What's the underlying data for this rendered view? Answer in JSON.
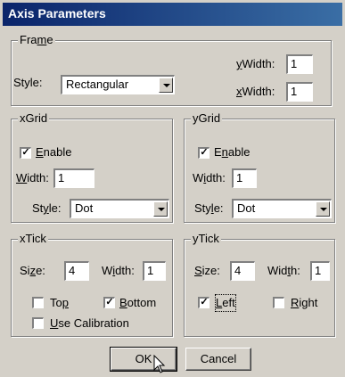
{
  "window": {
    "title": "Axis Parameters"
  },
  "frame": {
    "label_pre": "Fra",
    "label_u": "m",
    "label_post": "e",
    "style_label": "Style:",
    "style_value": "Rectangular",
    "ywidth_u": "y",
    "ywidth_post": "Width:",
    "ywidth_value": "1",
    "xwidth_u": "x",
    "xwidth_post": "Width:",
    "xwidth_value": "1"
  },
  "xgrid": {
    "label": "xGrid",
    "enable_u": "E",
    "enable_post": "nable",
    "enable_checked": true,
    "width_u": "W",
    "width_post": "idth:",
    "width_value": "1",
    "style_pre": "St",
    "style_u": "y",
    "style_post": "le:",
    "style_value": "Dot"
  },
  "ygrid": {
    "label": "yGrid",
    "enable_pre": "E",
    "enable_u": "n",
    "enable_post": "able",
    "enable_checked": true,
    "width_pre": "W",
    "width_u": "i",
    "width_post": "dth:",
    "width_value": "1",
    "style_pre": "Sty",
    "style_u": "l",
    "style_post": "e:",
    "style_value": "Dot"
  },
  "xtick": {
    "label": "xTick",
    "size_pre": "Si",
    "size_u": "z",
    "size_post": "e:",
    "size_value": "4",
    "width_pre": "W",
    "width_u": "i",
    "width_post": "dth:",
    "width_value": "1",
    "top_pre": "To",
    "top_u": "p",
    "top_checked": false,
    "bottom_u": "B",
    "bottom_post": "ottom",
    "bottom_checked": true,
    "cal_u": "U",
    "cal_post": "se Calibration",
    "cal_checked": false
  },
  "ytick": {
    "label": "yTick",
    "size_u": "S",
    "size_post": "ize:",
    "size_value": "4",
    "width_pre": "Wid",
    "width_u": "t",
    "width_post": "h:",
    "width_value": "1",
    "left_u": "L",
    "left_post": "eft",
    "left_checked": true,
    "right_u": "R",
    "right_post": "ight",
    "right_checked": false
  },
  "buttons": {
    "ok": "OK",
    "cancel": "Cancel"
  },
  "check_mark": "✓"
}
